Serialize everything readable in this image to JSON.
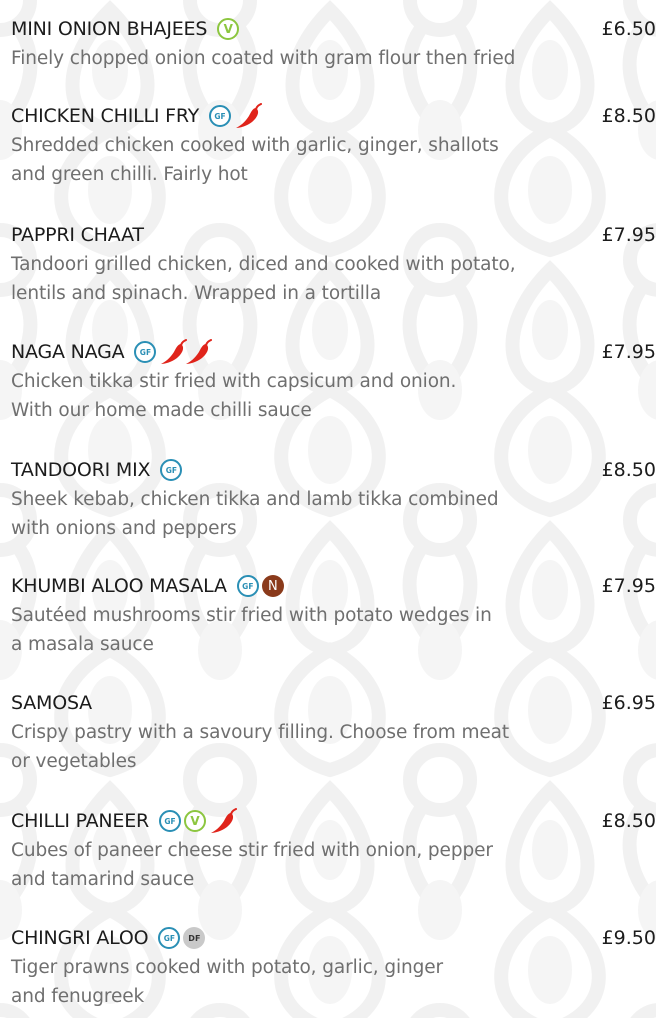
{
  "colors": {
    "vegetarian": "#8cc63f",
    "gluten_free": "#2a8fb5",
    "nuts": "#8a3a1b",
    "dairy_free": "#c9c9c9",
    "chilli": "#e0241b",
    "description_text": "#6f6f6f"
  },
  "badge_labels": {
    "v": "V",
    "gf": "GF",
    "n": "N",
    "df": "DF"
  },
  "items": [
    {
      "name": "MINI ONION BHAJEES",
      "price": "£6.50",
      "description": "Finely chopped onion coated with gram flour then fried",
      "badges": [
        "v"
      ],
      "chillies": 0
    },
    {
      "name": "CHICKEN CHILLI FRY",
      "price": "£8.50",
      "description": "Shredded chicken cooked with garlic, ginger, shallots\nand green chilli. Fairly hot",
      "badges": [
        "gf"
      ],
      "chillies": 1
    },
    {
      "name": "PAPPRI CHAAT",
      "price": "£7.95",
      "description": "Tandoori grilled chicken, diced and cooked with potato,\nlentils and spinach. Wrapped in a tortilla",
      "badges": [],
      "chillies": 0
    },
    {
      "name": "NAGA NAGA",
      "price": "£7.95",
      "description": "Chicken tikka stir fried with capsicum and onion.\nWith our home made chilli sauce",
      "badges": [
        "gf"
      ],
      "chillies": 2
    },
    {
      "name": "TANDOORI MIX",
      "price": "£8.50",
      "description": "Sheek kebab, chicken tikka and lamb tikka combined\nwith onions and peppers",
      "badges": [
        "gf"
      ],
      "chillies": 0
    },
    {
      "name": "KHUMBI ALOO MASALA",
      "price": "£7.95",
      "description": "Sautéed mushrooms stir fried with potato wedges in\na masala sauce",
      "badges": [
        "gf",
        "n"
      ],
      "chillies": 0
    },
    {
      "name": "SAMOSA",
      "price": "£6.95",
      "description": "Crispy pastry with a savoury filling. Choose from meat\nor vegetables",
      "badges": [],
      "chillies": 0
    },
    {
      "name": "CHILLI PANEER",
      "price": "£8.50",
      "description": "Cubes of paneer cheese stir fried with onion, pepper\nand tamarind sauce",
      "badges": [
        "gf",
        "v"
      ],
      "chillies": 1
    },
    {
      "name": "CHINGRI ALOO",
      "price": "£9.50",
      "description": "Tiger prawns cooked with potato, garlic, ginger\nand fenugreek",
      "badges": [
        "gf",
        "df"
      ],
      "chillies": 0
    }
  ]
}
